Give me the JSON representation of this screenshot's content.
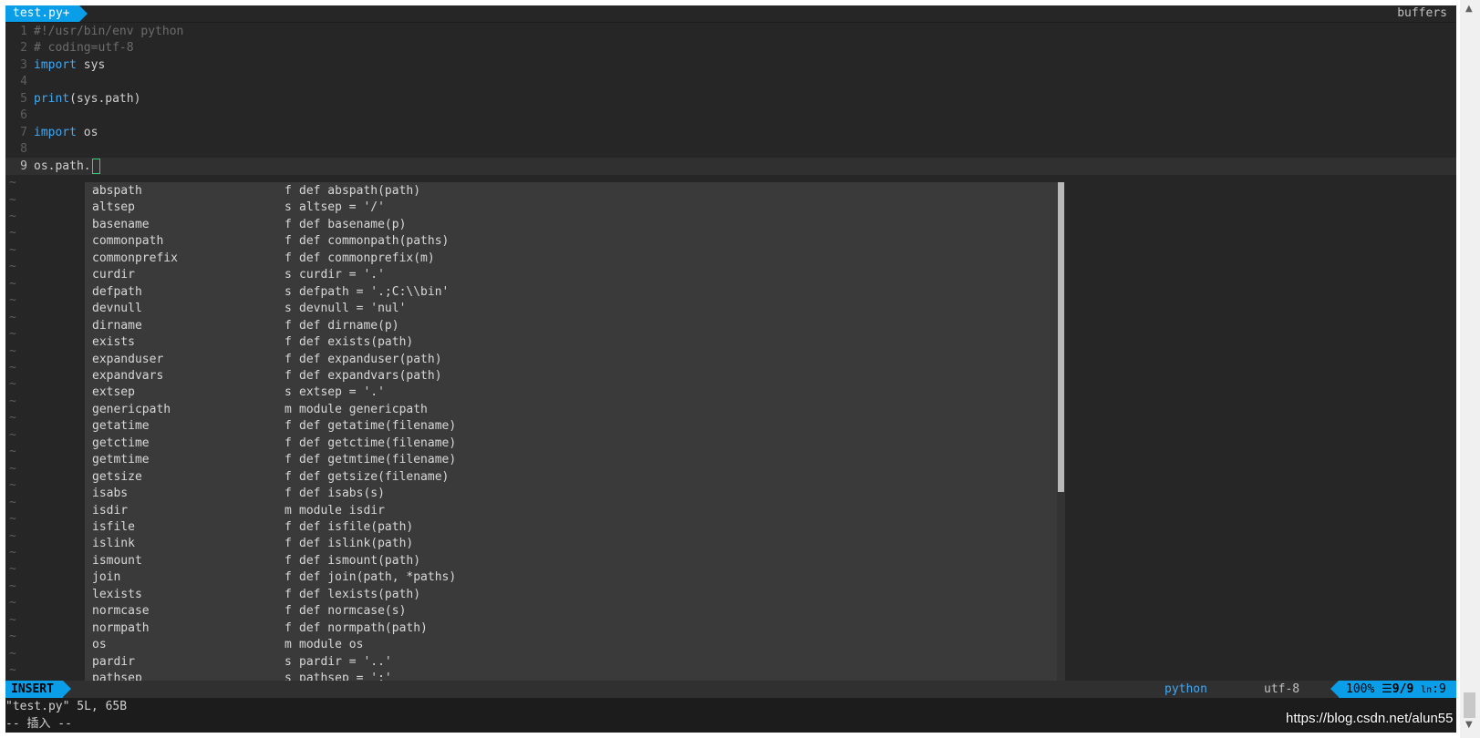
{
  "tabline": {
    "active_tab": "test.py+",
    "right_label": "buffers"
  },
  "editor": {
    "lines": [
      {
        "num": "1",
        "parts": [
          {
            "t": "#!/usr/bin/env python",
            "c": "cm"
          }
        ]
      },
      {
        "num": "2",
        "parts": [
          {
            "t": "# coding=utf-8",
            "c": "cm"
          }
        ]
      },
      {
        "num": "3",
        "parts": [
          {
            "t": "import",
            "c": "kw"
          },
          {
            "t": " sys",
            "c": ""
          }
        ]
      },
      {
        "num": "4",
        "parts": []
      },
      {
        "num": "5",
        "parts": [
          {
            "t": "print",
            "c": "kw"
          },
          {
            "t": "(sys.path)",
            "c": ""
          }
        ]
      },
      {
        "num": "6",
        "parts": []
      },
      {
        "num": "7",
        "parts": [
          {
            "t": "import",
            "c": "kw"
          },
          {
            "t": " os",
            "c": ""
          }
        ]
      },
      {
        "num": "8",
        "parts": []
      },
      {
        "num": "9",
        "parts": [
          {
            "t": "os.path.",
            "c": ""
          }
        ],
        "current": true
      }
    ],
    "tilde": "~"
  },
  "completion": {
    "items": [
      {
        "word": "abspath",
        "kind": "f",
        "menu": "def abspath(path)"
      },
      {
        "word": "altsep",
        "kind": "s",
        "menu": "altsep = '/'"
      },
      {
        "word": "basename",
        "kind": "f",
        "menu": "def basename(p)"
      },
      {
        "word": "commonpath",
        "kind": "f",
        "menu": "def commonpath(paths)"
      },
      {
        "word": "commonprefix",
        "kind": "f",
        "menu": "def commonprefix(m)"
      },
      {
        "word": "curdir",
        "kind": "s",
        "menu": "curdir = '.'"
      },
      {
        "word": "defpath",
        "kind": "s",
        "menu": "defpath = '.;C:\\\\bin'"
      },
      {
        "word": "devnull",
        "kind": "s",
        "menu": "devnull = 'nul'"
      },
      {
        "word": "dirname",
        "kind": "f",
        "menu": "def dirname(p)"
      },
      {
        "word": "exists",
        "kind": "f",
        "menu": "def exists(path)"
      },
      {
        "word": "expanduser",
        "kind": "f",
        "menu": "def expanduser(path)"
      },
      {
        "word": "expandvars",
        "kind": "f",
        "menu": "def expandvars(path)"
      },
      {
        "word": "extsep",
        "kind": "s",
        "menu": "extsep = '.'"
      },
      {
        "word": "genericpath",
        "kind": "m",
        "menu": "module genericpath"
      },
      {
        "word": "getatime",
        "kind": "f",
        "menu": "def getatime(filename)"
      },
      {
        "word": "getctime",
        "kind": "f",
        "menu": "def getctime(filename)"
      },
      {
        "word": "getmtime",
        "kind": "f",
        "menu": "def getmtime(filename)"
      },
      {
        "word": "getsize",
        "kind": "f",
        "menu": "def getsize(filename)"
      },
      {
        "word": "isabs",
        "kind": "f",
        "menu": "def isabs(s)"
      },
      {
        "word": "isdir",
        "kind": "m",
        "menu": "module isdir"
      },
      {
        "word": "isfile",
        "kind": "f",
        "menu": "def isfile(path)"
      },
      {
        "word": "islink",
        "kind": "f",
        "menu": "def islink(path)"
      },
      {
        "word": "ismount",
        "kind": "f",
        "menu": "def ismount(path)"
      },
      {
        "word": "join",
        "kind": "f",
        "menu": "def join(path, *paths)"
      },
      {
        "word": "lexists",
        "kind": "f",
        "menu": "def lexists(path)"
      },
      {
        "word": "normcase",
        "kind": "f",
        "menu": "def normcase(s)"
      },
      {
        "word": "normpath",
        "kind": "f",
        "menu": "def normpath(path)"
      },
      {
        "word": "os",
        "kind": "m",
        "menu": "module os"
      },
      {
        "word": "pardir",
        "kind": "s",
        "menu": "pardir = '..'"
      },
      {
        "word": "pathsep",
        "kind": "s",
        "menu": "pathsep = ';'"
      }
    ]
  },
  "statusline": {
    "mode": "INSERT",
    "filetype": "python",
    "encoding": "utf-8",
    "percent": "100%",
    "line_icon": "☰",
    "line_pos": "9/9",
    "col_icon": "ln",
    "col_pos": ":9"
  },
  "cmdline": {
    "line1": "\"test.py\" 5L, 65B",
    "line2": "-- 插入 --"
  },
  "watermark": "https://blog.csdn.net/alun55",
  "colors": {
    "accent": "#0a9ee8",
    "keyword": "#3fa9f5",
    "cursor": "#33d17a"
  }
}
